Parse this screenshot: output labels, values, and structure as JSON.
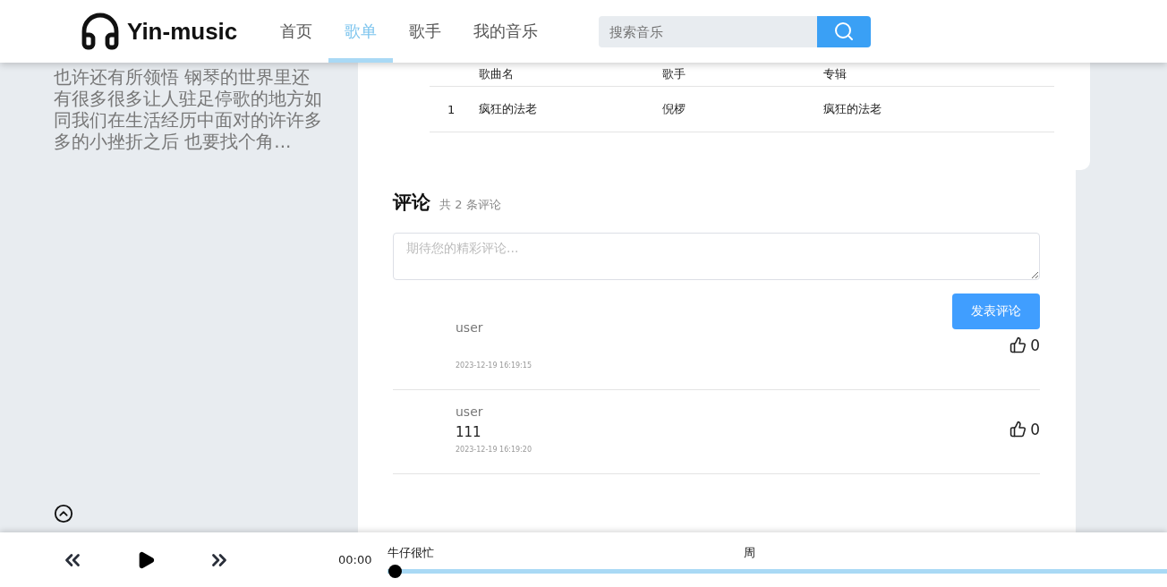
{
  "header": {
    "logo": "Yin-music",
    "nav": [
      {
        "label": "首页",
        "selected": false
      },
      {
        "label": "歌单",
        "selected": true
      },
      {
        "label": "歌手",
        "selected": false
      },
      {
        "label": "我的音乐",
        "selected": false
      }
    ],
    "search": {
      "placeholder": "搜索音乐"
    }
  },
  "sidebar": {
    "description": "也许还有所领悟 钢琴的世界里还有很多很多让人驻足停歌的地方如同我们在生活经历中面对的许许多多的小挫折之后 也要找个角..."
  },
  "songs": {
    "columns": [
      "歌曲名",
      "歌手",
      "专辑"
    ],
    "rows": [
      {
        "index": "1",
        "title": "疯狂的法老",
        "singer": "倪椤",
        "album": "疯狂的法老"
      }
    ]
  },
  "comments": {
    "title": "评论",
    "count": "共 2 条评论",
    "placeholder": "期待您的精彩评论...",
    "submit": "发表评论",
    "items": [
      {
        "user": "user",
        "time": "2023-12-19 16:19:15",
        "likes": "0"
      },
      {
        "user": "user",
        "text": "111",
        "time": "2023-12-19 16:19:20",
        "likes": "0"
      }
    ]
  },
  "player": {
    "time": "00:00",
    "title": "牛仔很忙",
    "artist": "周",
    "level": 0
  }
}
